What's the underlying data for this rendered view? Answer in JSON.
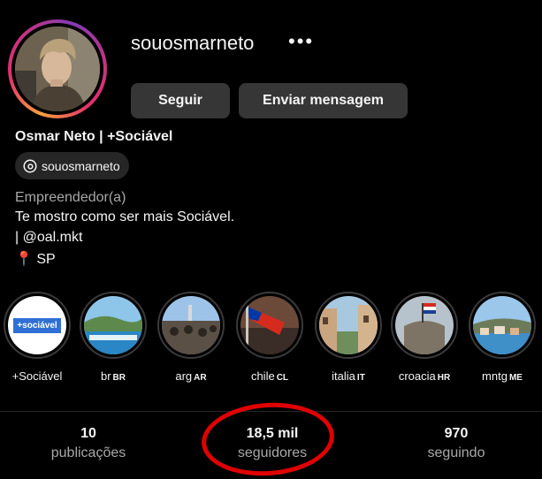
{
  "profile": {
    "username": "souosmarneto",
    "full_name": "Osmar Neto | +Sociável",
    "threads_handle": "souosmarneto",
    "category": "Empreendedor(a)",
    "bio": [
      "Te mostro como ser mais Sociável.",
      "| @oal.mkt",
      "SP"
    ],
    "avatar_ring_colors": [
      "#f9a13c",
      "#e1306c",
      "#833ab4"
    ]
  },
  "actions": {
    "follow_label": "Seguir",
    "message_label": "Enviar mensagem",
    "more_icon": "ellipsis-icon"
  },
  "highlights": [
    {
      "label": "+Sociável",
      "code": ""
    },
    {
      "label": "br",
      "code": "BR"
    },
    {
      "label": "arg",
      "code": "AR"
    },
    {
      "label": "chile",
      "code": "CL"
    },
    {
      "label": "italia",
      "code": "IT"
    },
    {
      "label": "croacia",
      "code": "HR"
    },
    {
      "label": "mntg",
      "code": "ME"
    }
  ],
  "highlight_cover_text": "+sociável",
  "stats": [
    {
      "value": "10",
      "label": "publicações"
    },
    {
      "value": "18,5 mil",
      "label": "seguidores"
    },
    {
      "value": "970",
      "label": "seguindo"
    }
  ],
  "annotation_color": "#e00000"
}
